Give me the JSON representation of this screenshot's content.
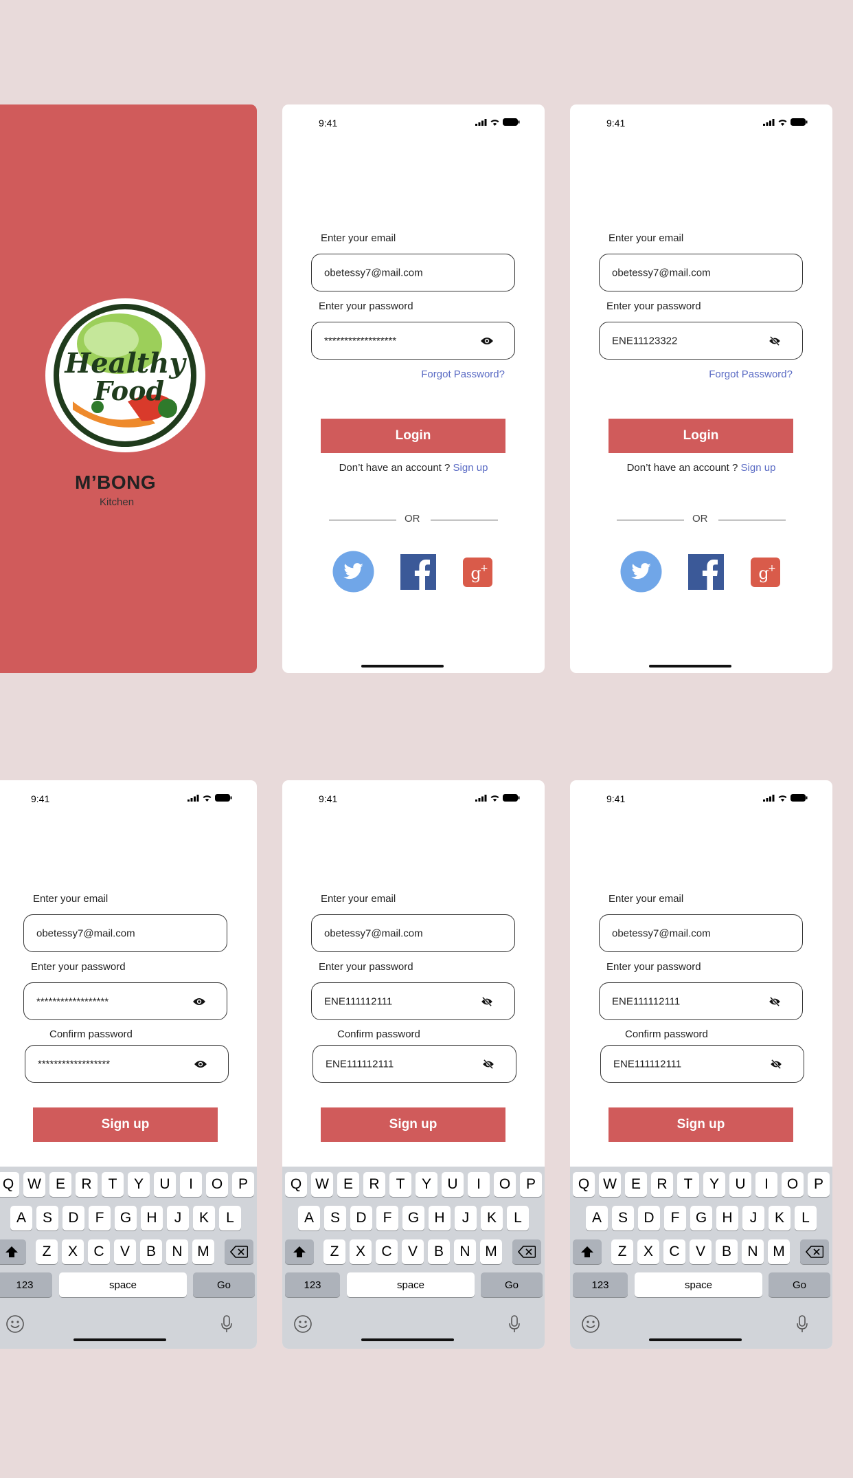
{
  "status": {
    "time": "9:41"
  },
  "splash": {
    "logo_text_1": "Healthy",
    "logo_text_2": "Food",
    "brand": "M’BONG",
    "sub": "Kitchen"
  },
  "login": {
    "email_label": "Enter your email",
    "email_value": "obetessy7@mail.com",
    "password_label": "Enter your password",
    "password_masked": "******************",
    "password_revealed": "ENE11123322",
    "forgot": "Forgot Password?",
    "button": "Login",
    "no_account": "Don’t have an account ?",
    "signup_link": "Sign up",
    "or": "OR"
  },
  "signup": {
    "email_label": "Enter your email",
    "email_value": "obetessy7@mail.com",
    "password_label": "Enter your password",
    "confirm_label": "Confirm password",
    "password_masked": "******************",
    "password_revealed": "ENE111112111",
    "button": "Sign up"
  },
  "keyboard": {
    "row1": [
      "Q",
      "W",
      "E",
      "R",
      "T",
      "Y",
      "U",
      "I",
      "O",
      "P"
    ],
    "row2": [
      "A",
      "S",
      "D",
      "F",
      "G",
      "H",
      "J",
      "K",
      "L"
    ],
    "row3": [
      "Z",
      "X",
      "C",
      "V",
      "B",
      "N",
      "M"
    ],
    "numbers": "123",
    "space": "space",
    "go": "Go"
  },
  "icons": {
    "eye": "eye-icon",
    "eye_off": "eye-off-icon",
    "twitter": "twitter-icon",
    "facebook": "facebook-icon",
    "google_plus": "google-plus-icon",
    "shift": "shift-icon",
    "backspace": "backspace-icon",
    "emoji": "emoji-icon",
    "mic": "mic-icon"
  },
  "colors": {
    "brand_red": "#d05b5b",
    "link_blue": "#5a6bc4",
    "background": "#e8dada"
  }
}
